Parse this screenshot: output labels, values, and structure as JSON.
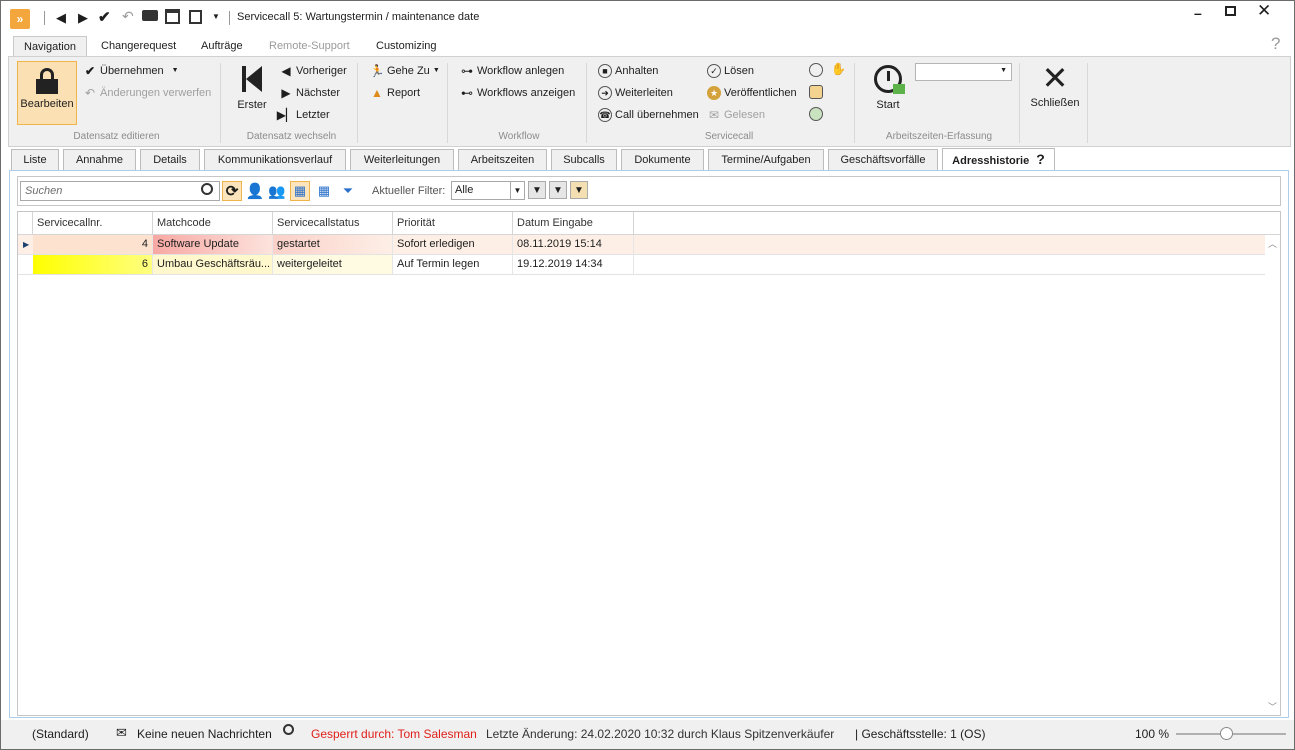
{
  "window": {
    "title": "Servicecall 5: Wartungstermin / maintenance date"
  },
  "ribbon_tabs": [
    "Navigation",
    "Changerequest",
    "Aufträge",
    "Remote-Support",
    "Customizing"
  ],
  "ribbon": {
    "edit": {
      "bearbeiten": "Bearbeiten",
      "uebernehmen": "Übernehmen",
      "verwerfen": "Änderungen verwerfen",
      "label": "Datensatz editieren"
    },
    "nav": {
      "erster": "Erster",
      "vorheriger": "Vorheriger",
      "naechster": "Nächster",
      "letzter": "Letzter",
      "label": "Datensatz wechseln"
    },
    "gehe": {
      "gehe_zu": "Gehe Zu",
      "report": "Report"
    },
    "workflow": {
      "anlegen": "Workflow anlegen",
      "anzeigen": "Workflows anzeigen",
      "label": "Workflow"
    },
    "servicecall": {
      "anhalten": "Anhalten",
      "weiterleiten": "Weiterleiten",
      "uebernehmen": "Call übernehmen",
      "loesen": "Lösen",
      "veroeffentlichen": "Veröffentlichen",
      "gelesen": "Gelesen",
      "label": "Servicecall"
    },
    "zeit": {
      "start": "Start",
      "label": "Arbeitszeiten-Erfassung"
    },
    "close": {
      "schliessen": "Schließen"
    }
  },
  "content_tabs": [
    "Liste",
    "Annahme",
    "Details",
    "Kommunikationsverlauf",
    "Weiterleitungen",
    "Arbeitszeiten",
    "Subcalls",
    "Dokumente",
    "Termine/Aufgaben",
    "Geschäftsvorfälle",
    "Adresshistorie"
  ],
  "toolbar": {
    "search_placeholder": "Suchen",
    "filter_label": "Aktueller Filter:",
    "filter_value": "Alle"
  },
  "grid": {
    "columns": [
      "Servicecallnr.",
      "Matchcode",
      "Servicecallstatus",
      "Priorität",
      "Datum Eingabe"
    ],
    "rows": [
      {
        "nr": "4",
        "matchcode": "Software Update",
        "status": "gestartet",
        "prio": "Sofort erledigen",
        "datum": "08.11.2019 15:14"
      },
      {
        "nr": "6",
        "matchcode": "Umbau Geschäftsräu...",
        "status": "weitergeleitet",
        "prio": "Auf Termin legen",
        "datum": "19.12.2019 14:34"
      }
    ]
  },
  "statusbar": {
    "standard": "(Standard)",
    "nachrichten": "Keine neuen Nachrichten",
    "gesperrt": "Gesperrt durch: Tom Salesman",
    "aenderung": "Letzte Änderung: 24.02.2020 10:32 durch Klaus Spitzenverkäufer",
    "geschaeftsstelle": "| Geschäftsstelle:  1 (OS)",
    "zoom": "100 %"
  },
  "colors": {
    "accent": "#f6c25a",
    "row1_bg": "#fde7dd",
    "row2_yellow": "#ffff00",
    "locked_red": "#e0201b"
  }
}
